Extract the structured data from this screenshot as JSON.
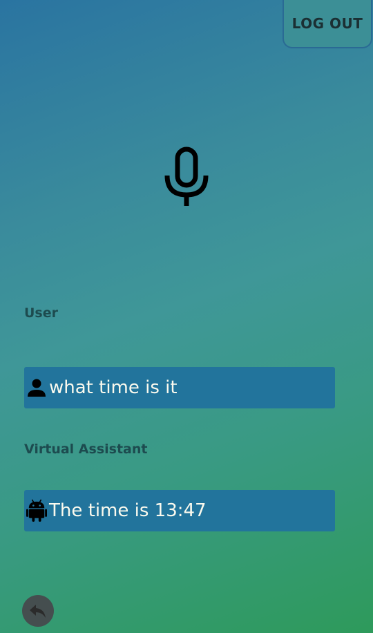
{
  "header": {
    "logout_label": "LOG OUT"
  },
  "mic": {
    "icon": "microphone-icon"
  },
  "conversation": {
    "user_label": "User",
    "user_message": "what time is it",
    "user_icon": "person-icon",
    "assistant_label": "Virtual Assistant",
    "assistant_message": "The time is 13:47",
    "assistant_icon": "android-icon"
  },
  "footer": {
    "back_icon": "reply-arrow-icon"
  },
  "colors": {
    "message_background": "#22749c",
    "message_text": "#fbfaee",
    "label_text": "#1d4b4f"
  }
}
